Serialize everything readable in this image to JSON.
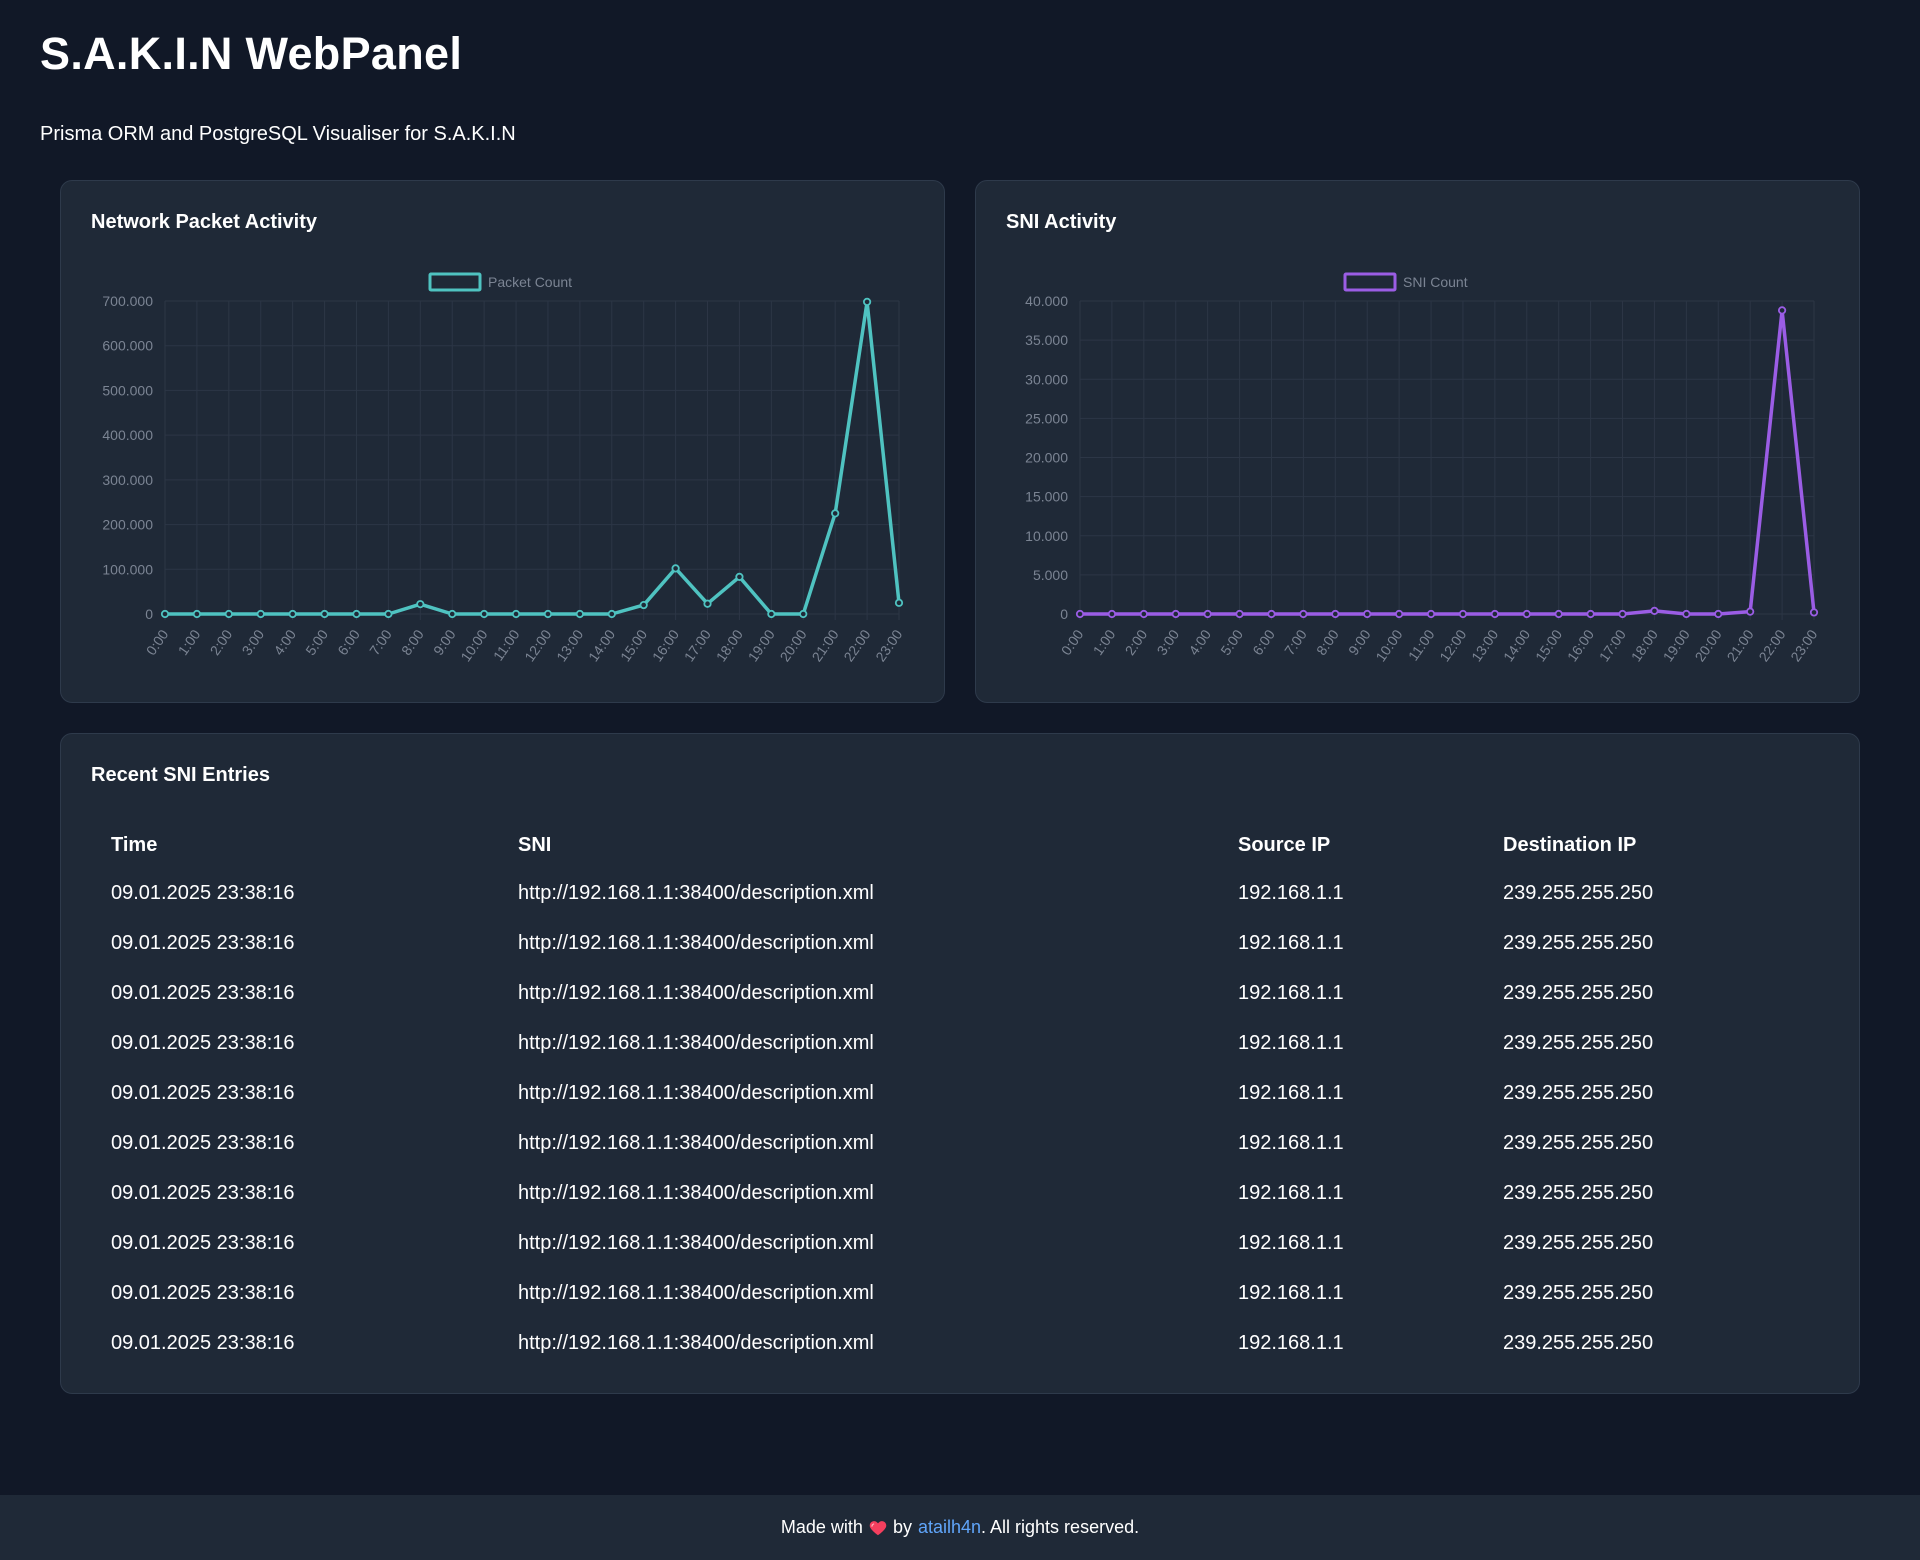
{
  "header": {
    "title": "S.A.K.I.N WebPanel",
    "subtitle": "Prisma ORM and PostgreSQL Visualiser for S.A.K.I.N"
  },
  "charts": {
    "packets": {
      "card_title": "Network Packet Activity"
    },
    "sni": {
      "card_title": "SNI Activity"
    }
  },
  "chart_data": [
    {
      "type": "line",
      "title": "Network Packet Activity",
      "legend_position": "top-center",
      "grid": true,
      "color": "#4fc3c1",
      "categories": [
        "0:00",
        "1:00",
        "2:00",
        "3:00",
        "4:00",
        "5:00",
        "6:00",
        "7:00",
        "8:00",
        "9:00",
        "10:00",
        "11:00",
        "12:00",
        "13:00",
        "14:00",
        "15:00",
        "16:00",
        "17:00",
        "18:00",
        "19:00",
        "20:00",
        "21:00",
        "22:00",
        "23:00"
      ],
      "series": [
        {
          "name": "Packet Count",
          "values": [
            0,
            0,
            0,
            0,
            0,
            0,
            0,
            0,
            22000,
            0,
            0,
            0,
            0,
            0,
            0,
            20000,
            102000,
            23000,
            83000,
            0,
            0,
            225000,
            698000,
            25000
          ]
        }
      ],
      "ylim": [
        0,
        700000
      ],
      "yticks": [
        0,
        100000,
        200000,
        300000,
        400000,
        500000,
        600000,
        700000
      ],
      "ytick_labels": [
        "0",
        "100.000",
        "200.000",
        "300.000",
        "400.000",
        "500.000",
        "600.000",
        "700.000"
      ]
    },
    {
      "type": "line",
      "title": "SNI Activity",
      "legend_position": "top-center",
      "grid": true,
      "color": "#9b5de5",
      "categories": [
        "0:00",
        "1:00",
        "2:00",
        "3:00",
        "4:00",
        "5:00",
        "6:00",
        "7:00",
        "8:00",
        "9:00",
        "10:00",
        "11:00",
        "12:00",
        "13:00",
        "14:00",
        "15:00",
        "16:00",
        "17:00",
        "18:00",
        "19:00",
        "20:00",
        "21:00",
        "22:00",
        "23:00"
      ],
      "series": [
        {
          "name": "SNI Count",
          "values": [
            0,
            0,
            0,
            0,
            0,
            0,
            0,
            0,
            0,
            0,
            0,
            0,
            0,
            0,
            0,
            0,
            0,
            0,
            400,
            0,
            0,
            300,
            38800,
            200
          ]
        }
      ],
      "ylim": [
        0,
        40000
      ],
      "yticks": [
        0,
        5000,
        10000,
        15000,
        20000,
        25000,
        30000,
        35000,
        40000
      ],
      "ytick_labels": [
        "0",
        "5.000",
        "10.000",
        "15.000",
        "20.000",
        "25.000",
        "30.000",
        "35.000",
        "40.000"
      ]
    }
  ],
  "sni_table": {
    "card_title": "Recent SNI Entries",
    "headers": [
      "Time",
      "SNI",
      "Source IP",
      "Destination IP"
    ],
    "rows": [
      [
        "09.01.2025 23:38:16",
        "http://192.168.1.1:38400/description.xml",
        "192.168.1.1",
        "239.255.255.250"
      ],
      [
        "09.01.2025 23:38:16",
        "http://192.168.1.1:38400/description.xml",
        "192.168.1.1",
        "239.255.255.250"
      ],
      [
        "09.01.2025 23:38:16",
        "http://192.168.1.1:38400/description.xml",
        "192.168.1.1",
        "239.255.255.250"
      ],
      [
        "09.01.2025 23:38:16",
        "http://192.168.1.1:38400/description.xml",
        "192.168.1.1",
        "239.255.255.250"
      ],
      [
        "09.01.2025 23:38:16",
        "http://192.168.1.1:38400/description.xml",
        "192.168.1.1",
        "239.255.255.250"
      ],
      [
        "09.01.2025 23:38:16",
        "http://192.168.1.1:38400/description.xml",
        "192.168.1.1",
        "239.255.255.250"
      ],
      [
        "09.01.2025 23:38:16",
        "http://192.168.1.1:38400/description.xml",
        "192.168.1.1",
        "239.255.255.250"
      ],
      [
        "09.01.2025 23:38:16",
        "http://192.168.1.1:38400/description.xml",
        "192.168.1.1",
        "239.255.255.250"
      ],
      [
        "09.01.2025 23:38:16",
        "http://192.168.1.1:38400/description.xml",
        "192.168.1.1",
        "239.255.255.250"
      ],
      [
        "09.01.2025 23:38:16",
        "http://192.168.1.1:38400/description.xml",
        "192.168.1.1",
        "239.255.255.250"
      ]
    ]
  },
  "footer": {
    "prefix": "Made with",
    "heart_icon": "heart-icon",
    "by": "by",
    "author": "atailh4n",
    "suffix": ". All rights reserved."
  },
  "colors": {
    "background": "#111827",
    "card": "#1f2937",
    "packet_line": "#4fc3c1",
    "sni_line": "#9b5de5",
    "link": "#60a5fa",
    "heart": "#f43f5e"
  }
}
